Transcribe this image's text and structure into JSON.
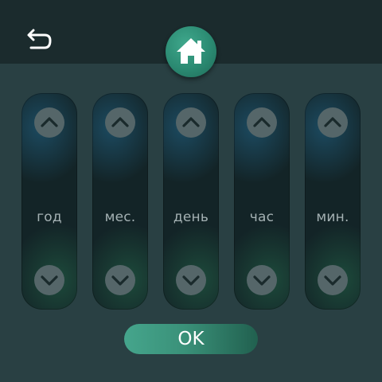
{
  "header": {
    "back_icon": "back-arrow-icon",
    "home_icon": "home-icon"
  },
  "columns": [
    {
      "label": "год"
    },
    {
      "label": "мес."
    },
    {
      "label": "день"
    },
    {
      "label": "час"
    },
    {
      "label": "мин."
    }
  ],
  "icons": {
    "up": "chevron-up-icon",
    "down": "chevron-down-icon"
  },
  "ok_button": {
    "label": "OK"
  },
  "colors": {
    "accent": "#3a9179",
    "background": "#294043",
    "header": "#1b2b2d"
  }
}
